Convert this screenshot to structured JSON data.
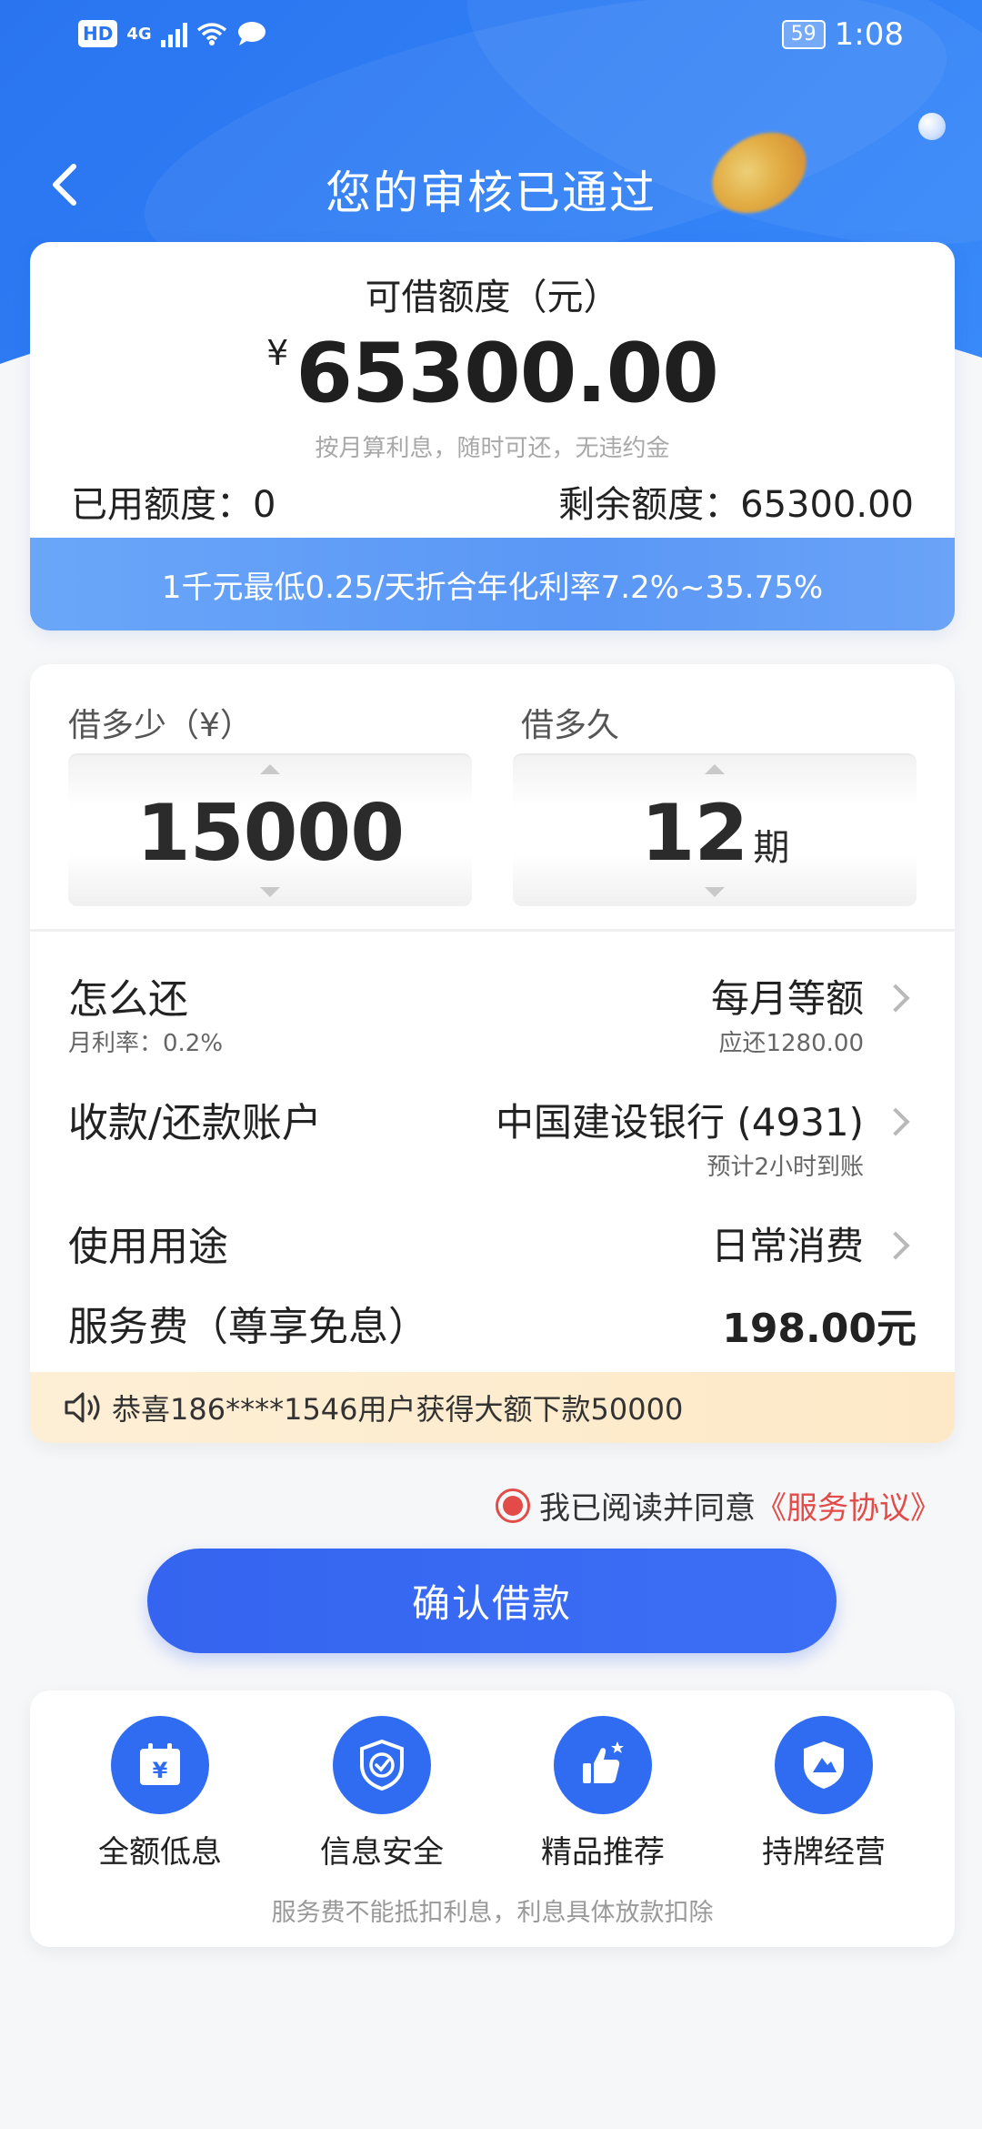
{
  "status_bar": {
    "hd": "HD",
    "network": "4G",
    "battery": "59",
    "time": "1:08"
  },
  "nav": {
    "title": "您的审核已通过"
  },
  "credit": {
    "label": "可借额度（元）",
    "currency": "¥",
    "amount": "65300.00",
    "subtitle": "按月算利息，随时可还，无违约金",
    "used": "已用额度：0",
    "remaining": "剩余额度：65300.00",
    "rate_banner": "1千元最低0.25/天折合年化利率7.2%~35.75%"
  },
  "loan": {
    "amount_label": "借多少（¥）",
    "term_label": "借多久",
    "amount_value": "15000",
    "term_value": "12",
    "term_unit": "期"
  },
  "rows": {
    "repay_title": "怎么还",
    "repay_value": "每月等额",
    "repay_rate": "月利率：0.2%",
    "repay_due": "应还1280.00",
    "account_title": "收款/还款账户",
    "account_value": "中国建设银行 (4931)",
    "account_eta": "预计2小时到账",
    "purpose_title": "使用用途",
    "purpose_value": "日常消费",
    "fee_title": "服务费（尊享免息）",
    "fee_value": "198.00元"
  },
  "notice": {
    "text": "恭喜186****1546用户获得大额下款50000"
  },
  "agreement": {
    "text": "我已阅读并同意",
    "link": "《服务协议》"
  },
  "confirm_button": "确认借款",
  "features": [
    {
      "label": "全额低息",
      "icon": "calendar-yen-icon"
    },
    {
      "label": "信息安全",
      "icon": "shield-check-icon"
    },
    {
      "label": "精品推荐",
      "icon": "thumbs-up-icon"
    },
    {
      "label": "持牌经营",
      "icon": "license-shield-icon"
    }
  ],
  "footer_note": "服务费不能抵扣利息，利息具体放款扣除",
  "colors": {
    "primary": "#2f6cf2",
    "accent_red": "#e24b48",
    "notice_bg": "#fdefd6"
  }
}
